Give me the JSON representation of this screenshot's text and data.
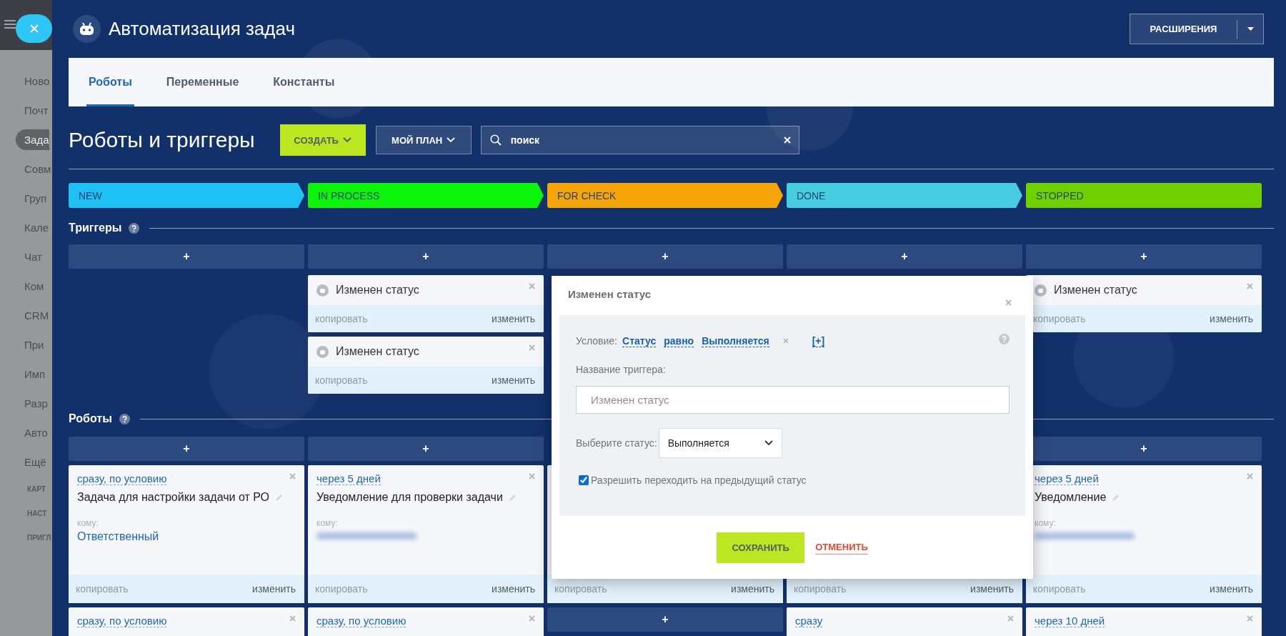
{
  "sidebar": {
    "items": [
      {
        "label": "Ново",
        "selected": false
      },
      {
        "label": "Почт",
        "selected": false
      },
      {
        "label": "Зада",
        "selected": true
      },
      {
        "label": "Совм",
        "selected": false
      },
      {
        "label": "Груп",
        "selected": false
      },
      {
        "label": "Кале",
        "selected": false
      },
      {
        "label": "Чат",
        "selected": false
      },
      {
        "label": "Ком",
        "selected": false
      },
      {
        "label": "CRM",
        "selected": false
      },
      {
        "label": "При",
        "selected": false
      },
      {
        "label": "Имп",
        "selected": false
      },
      {
        "label": "Разр",
        "selected": false
      },
      {
        "label": "Авто",
        "selected": false
      },
      {
        "label": "Ещё",
        "selected": false
      }
    ],
    "sections": [
      "КАРТ",
      "НАСТ",
      "ПРИГЛ"
    ]
  },
  "header": {
    "title": "Автоматизация задач",
    "extensions_button": "РАСШИРЕНИЯ"
  },
  "tabs": [
    {
      "label": "Роботы",
      "selected": true
    },
    {
      "label": "Переменные",
      "selected": false
    },
    {
      "label": "Константы",
      "selected": false
    }
  ],
  "toolbar": {
    "title": "Роботы и триггеры",
    "create_button": "СОЗДАТЬ",
    "plan_button": "МОЙ ПЛАН",
    "search": {
      "placeholder": "поиск"
    }
  },
  "stages": [
    {
      "label": "NEW",
      "color": "#1ec0f5"
    },
    {
      "label": "IN PROCESS",
      "color": "#0cf40c"
    },
    {
      "label": "FOR CHECK",
      "color": "#f5a40a"
    },
    {
      "label": "DONE",
      "color": "#47cde2"
    },
    {
      "label": "STOPPED",
      "color": "#6fd200"
    }
  ],
  "triggers": {
    "title": "Триггеры",
    "columns": [
      {
        "add": "+"
      },
      {
        "add": "+",
        "cards": [
          {
            "title": "Изменен статус",
            "copy": "копировать",
            "edit": "изменить"
          },
          {
            "title": "Изменен статус",
            "copy": "копировать",
            "edit": "изменить"
          }
        ]
      },
      {
        "add": "+"
      },
      {
        "add": "+"
      },
      {
        "add": "+",
        "cards": [
          {
            "title": "Изменен статус",
            "copy": "копировать",
            "edit": "изменить"
          }
        ]
      }
    ]
  },
  "robots": {
    "title": "Роботы",
    "columns": [
      {
        "add": "+",
        "items": [
          {
            "kind": "card",
            "timing": "сразу, по условию",
            "title": "Задача для настройки задачи от РО",
            "to_label": "кому:",
            "recipient": {
              "kind": "text",
              "text": "Ответственный"
            },
            "copy": "копировать",
            "edit": "изменить"
          },
          {
            "kind": "card",
            "timing": "сразу, по условию"
          }
        ]
      },
      {
        "add": "+",
        "items": [
          {
            "kind": "card",
            "timing": "через 5 дней",
            "title": "Уведомление для проверки задачи",
            "to_label": "кому:",
            "recipient": {
              "kind": "blurred"
            },
            "copy": "копировать",
            "edit": "изменить"
          },
          {
            "kind": "card",
            "timing": "сразу, по условию"
          }
        ]
      },
      {
        "items": [
          {
            "kind": "card",
            "copy": "копировать",
            "edit": "изменить"
          },
          {
            "kind": "add",
            "label": "+"
          }
        ]
      },
      {
        "items": [
          {
            "kind": "card",
            "copy": "копировать",
            "edit": "изменить"
          },
          {
            "kind": "card",
            "timing": "сразу"
          }
        ]
      },
      {
        "add": "+",
        "items": [
          {
            "kind": "card",
            "timing": "через 5 дней",
            "title": "Уведомление",
            "to_label": "кому:",
            "recipient": {
              "kind": "blurred"
            },
            "copy": "копировать",
            "edit": "изменить"
          },
          {
            "kind": "card",
            "timing": "через 10 дней"
          }
        ]
      }
    ]
  },
  "dialog": {
    "title": "Изменен статус",
    "condition": {
      "label": "Условие:",
      "field": "Статус",
      "operator": "равно",
      "value": "Выполняется",
      "add": "[+]"
    },
    "name_label": "Название триггера:",
    "name_field": {
      "placeholder": "Изменен статус"
    },
    "status_label": "Выберите статус:",
    "status_select": {
      "value": "Выполняется"
    },
    "allow_back": {
      "label": "Разрешить переходить на предыдущий статус",
      "checked": true
    },
    "save_button": "СОХРАНИТЬ",
    "cancel_button": "ОТМЕНИТЬ"
  }
}
